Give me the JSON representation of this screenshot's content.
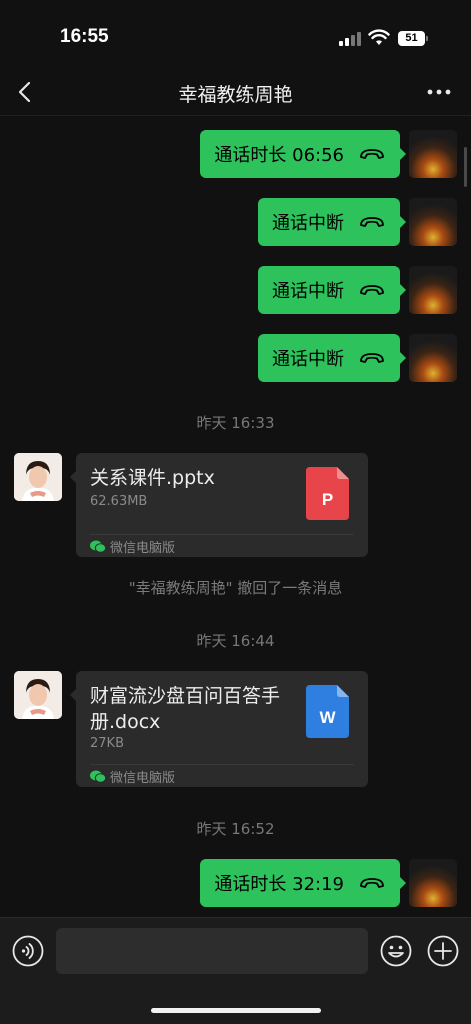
{
  "status_bar": {
    "time": "16:55",
    "battery": "51"
  },
  "nav": {
    "title": "幸福教练周艳"
  },
  "messages": {
    "call1": {
      "text": "通话时长 06:56"
    },
    "call2": {
      "text": "通话中断"
    },
    "call3": {
      "text": "通话中断"
    },
    "call4": {
      "text": "通话中断"
    },
    "ts1": "昨天 16:33",
    "file1": {
      "name": "关系课件.pptx",
      "size": "62.63MB",
      "source": "微信电脑版",
      "icon_letter": "P",
      "icon_color": "#e8454b"
    },
    "recall": "\"幸福教练周艳\" 撤回了一条消息",
    "ts2": "昨天 16:44",
    "file2": {
      "name": "财富流沙盘百问百答手册.docx",
      "size": "27KB",
      "source": "微信电脑版",
      "icon_letter": "W",
      "icon_color": "#2f7fe0"
    },
    "ts3": "昨天 16:52",
    "call5": {
      "text": "通话时长 32:19"
    }
  },
  "input": {
    "value": "",
    "placeholder": ""
  },
  "colors": {
    "bubble_green": "#2dc25b",
    "background": "#111111",
    "card": "#2b2b2b",
    "wechat_green": "#2dc25b"
  },
  "icons": [
    "back-icon",
    "more-icon",
    "phone-hangup-icon",
    "voice-icon",
    "emoji-icon",
    "plus-icon",
    "wechat-icon",
    "ppt-file-icon",
    "word-file-icon"
  ]
}
